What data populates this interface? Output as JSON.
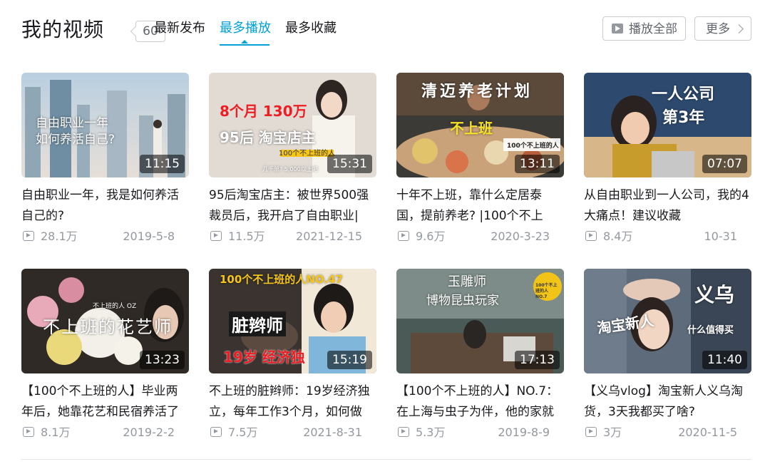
{
  "header": {
    "title": "我的视频",
    "count": "60",
    "tabs": [
      {
        "label": "最新发布"
      },
      {
        "label": "最多播放"
      },
      {
        "label": "最多收藏"
      }
    ],
    "play_all_label": "播放全部",
    "more_label": "更多"
  },
  "colors": {
    "accent": "#00a1d6",
    "muted": "#9499a0",
    "text": "#18191c"
  },
  "videos": [
    {
      "title": "自由职业一年，我是如何养活自己的?",
      "duration": "11:15",
      "views": "28.1万",
      "date": "2019-5-8",
      "overlay": [
        "自由职业一年",
        "如何养活自己?"
      ]
    },
    {
      "title": "95后淘宝店主：被世界500强裁员后，我开启了自由职业|",
      "duration": "15:31",
      "views": "11.5万",
      "date": "2021-12-15",
      "overlay": [
        "8个月 130万",
        "95后 淘宝店主",
        "100个不上班的人",
        "几千单? 5,000以上吧"
      ]
    },
    {
      "title": "十年不上班，靠什么定居泰国，提前养老? |100个不上",
      "duration": "13:11",
      "views": "9.6万",
      "date": "2020-3-23",
      "overlay": [
        "清迈养老计划",
        "不上班",
        "100个不上班的人"
      ]
    },
    {
      "title": "从自由职业到一人公司，我的4大痛点！建议收藏",
      "duration": "07:07",
      "views": "8.4万",
      "date": "10-31",
      "overlay": [
        "一人公司",
        "第3年"
      ]
    },
    {
      "title": "【100个不上班的人】毕业两年后，她靠花艺和民宿养活了",
      "duration": "13:23",
      "views": "8.1万",
      "date": "2019-2-2",
      "overlay": [
        "不上班的花艺师",
        "不上班的人 OZ"
      ]
    },
    {
      "title": "不上班的脏辫师：19岁经济独立，每年工作3个月，如何做",
      "duration": "15:19",
      "views": "7.5万",
      "date": "2021-8-31",
      "overlay": [
        "100个不上班的人NO.47",
        "脏辫师",
        "19岁 经济独"
      ]
    },
    {
      "title": "【100个不上班的人】NO.7：在上海与虫子为伴，他的家就",
      "duration": "17:13",
      "views": "5.3万",
      "date": "2019-8-9",
      "overlay": [
        "玉雕师",
        "博物昆虫玩家",
        "100个不上班的人 NO.7"
      ]
    },
    {
      "title": "【义乌vlog】淘宝新人义乌淘货，3天我都买了啥?",
      "duration": "11:40",
      "views": "3万",
      "date": "2020-11-5",
      "overlay": [
        "义乌",
        "淘宝新人",
        "什么值得买"
      ]
    }
  ]
}
